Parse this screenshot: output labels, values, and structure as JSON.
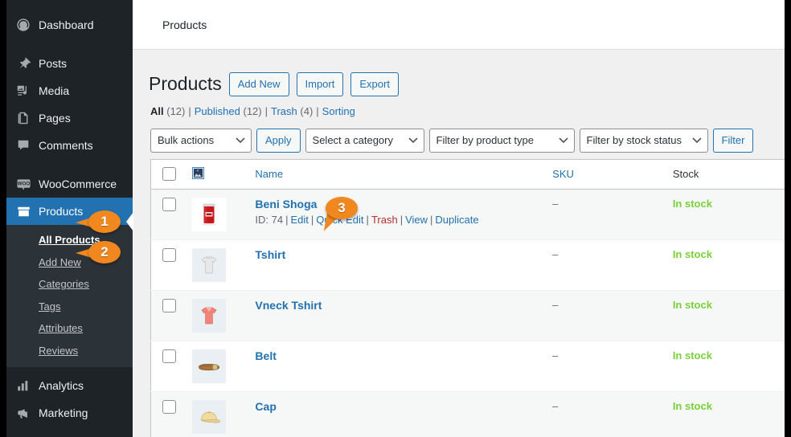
{
  "topbar": {
    "breadcrumb": "Products"
  },
  "sidebar": {
    "items": [
      {
        "label": "Dashboard",
        "icon": "dashboard-icon",
        "current": false
      },
      {
        "label": "Posts",
        "icon": "pin-icon",
        "current": false
      },
      {
        "label": "Media",
        "icon": "media-icon",
        "current": false
      },
      {
        "label": "Pages",
        "icon": "pages-icon",
        "current": false
      },
      {
        "label": "Comments",
        "icon": "comments-icon",
        "current": false
      },
      {
        "label": "WooCommerce",
        "icon": "woocommerce-icon",
        "current": false
      },
      {
        "label": "Products",
        "icon": "products-icon",
        "current": true
      },
      {
        "label": "Analytics",
        "icon": "analytics-icon",
        "current": false
      },
      {
        "label": "Marketing",
        "icon": "marketing-icon",
        "current": false
      }
    ],
    "submenu": [
      {
        "label": "All Products",
        "current": true
      },
      {
        "label": "Add New",
        "current": false
      },
      {
        "label": "Categories",
        "current": false
      },
      {
        "label": "Tags",
        "current": false
      },
      {
        "label": "Attributes",
        "current": false
      },
      {
        "label": "Reviews",
        "current": false
      }
    ]
  },
  "page": {
    "title": "Products",
    "actions": [
      {
        "label": "Add New",
        "name": "add-new-button"
      },
      {
        "label": "Import",
        "name": "import-button"
      },
      {
        "label": "Export",
        "name": "export-button"
      }
    ],
    "views": [
      {
        "label": "All",
        "count": "(12)",
        "current": true
      },
      {
        "label": "Published",
        "count": "(12)",
        "current": false
      },
      {
        "label": "Trash",
        "count": "(4)",
        "current": false
      },
      {
        "label": "Sorting",
        "count": "",
        "current": false
      }
    ],
    "separator": "|"
  },
  "tablenav": {
    "bulk_actions": "Bulk actions",
    "apply": "Apply",
    "category": "Select a category",
    "product_type": "Filter by product type",
    "stock_status": "Filter by stock status",
    "filter": "Filter",
    "caret": "⌄"
  },
  "table": {
    "columns": {
      "checkbox": "select-all",
      "image": "Image",
      "name": "Name",
      "sku": "SKU",
      "stock": "Stock"
    },
    "rows": [
      {
        "name": "Beni Shoga",
        "thumb": "jar-red",
        "sku": "–",
        "stock": "In stock",
        "id_label": "ID: 74",
        "actions": [
          {
            "label": "Edit",
            "kind": "link"
          },
          {
            "label": "Quick Edit",
            "kind": "link"
          },
          {
            "label": "Trash",
            "kind": "trash"
          },
          {
            "label": "View",
            "kind": "link"
          },
          {
            "label": "Duplicate",
            "kind": "link"
          }
        ]
      },
      {
        "name": "Tshirt",
        "thumb": "tshirt-grey",
        "sku": "–",
        "stock": "In stock",
        "id_label": "",
        "actions": []
      },
      {
        "name": "Vneck Tshirt",
        "thumb": "tshirt-pink",
        "sku": "–",
        "stock": "In stock",
        "id_label": "",
        "actions": []
      },
      {
        "name": "Belt",
        "thumb": "belt-brown",
        "sku": "–",
        "stock": "In stock",
        "id_label": "",
        "actions": []
      },
      {
        "name": "Cap",
        "thumb": "cap-tan",
        "sku": "–",
        "stock": "In stock",
        "id_label": "",
        "actions": []
      }
    ]
  },
  "callouts": [
    {
      "number": "1",
      "target": "sidebar-item-products"
    },
    {
      "number": "2",
      "target": "submenu-item-all-products"
    },
    {
      "number": "3",
      "target": "row-title-beni-shoga"
    }
  ],
  "colors": {
    "accent_blue": "#2271b1",
    "menu_bg": "#1d2327",
    "submenu_bg": "#2c3338",
    "callout_orange": "#f0881f",
    "instock_green": "#7ad03a",
    "trash_red": "#b32d2e"
  }
}
